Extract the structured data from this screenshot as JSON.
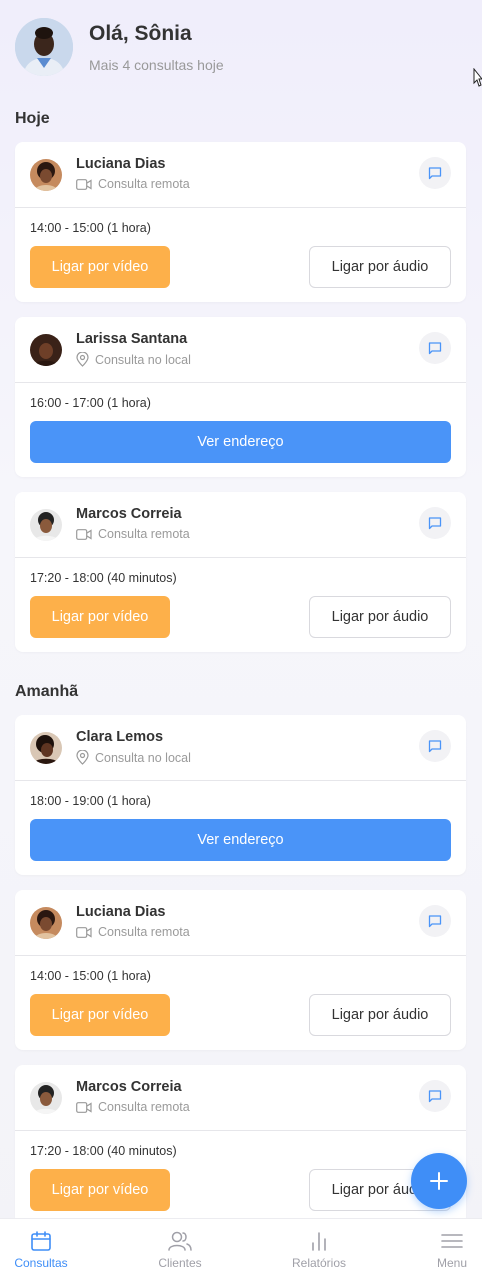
{
  "header": {
    "greeting": "Olá, Sônia",
    "subtitle": "Mais 4 consultas hoje"
  },
  "sections": [
    {
      "title": "Hoje",
      "cards": [
        {
          "name": "Luciana Dias",
          "type": "Consulta remota",
          "type_icon": "video-icon",
          "time": "14:00 - 15:00 (1 hora)",
          "primary": "Ligar por vídeo",
          "secondary": "Ligar por áudio"
        },
        {
          "name": "Larissa Santana",
          "type": "Consulta no local",
          "type_icon": "location-pin-icon",
          "time": "16:00 - 17:00 (1 hora)",
          "primary": "Ver endereço"
        },
        {
          "name": "Marcos Correia",
          "type": "Consulta remota",
          "type_icon": "video-icon",
          "time": "17:20 - 18:00 (40 minutos)",
          "primary": "Ligar por vídeo",
          "secondary": "Ligar por áudio"
        }
      ]
    },
    {
      "title": "Amanhã",
      "cards": [
        {
          "name": "Clara Lemos",
          "type": "Consulta no local",
          "type_icon": "location-pin-icon",
          "time": "18:00 - 19:00 (1 hora)",
          "primary": "Ver endereço"
        },
        {
          "name": "Luciana Dias",
          "type": "Consulta remota",
          "type_icon": "video-icon",
          "time": "14:00 - 15:00 (1 hora)",
          "primary": "Ligar por vídeo",
          "secondary": "Ligar por áudio"
        },
        {
          "name": "Marcos Correia",
          "type": "Consulta remota",
          "type_icon": "video-icon",
          "time": "17:20 - 18:00 (40 minutos)",
          "primary": "Ligar por vídeo",
          "secondary": "Ligar por áudio"
        }
      ]
    }
  ],
  "tabbar": {
    "items": [
      {
        "label": "Consultas",
        "icon": "calendar-icon",
        "active": true
      },
      {
        "label": "Clientes",
        "icon": "users-icon",
        "active": false
      },
      {
        "label": "Relatórios",
        "icon": "bar-chart-icon",
        "active": false
      },
      {
        "label": "Menu",
        "icon": "hamburger-menu-icon",
        "active": false
      }
    ]
  },
  "colors": {
    "accent_blue": "#4a94f8",
    "video_orange": "#fdb04a",
    "active_tab": "#3f8ef7"
  }
}
